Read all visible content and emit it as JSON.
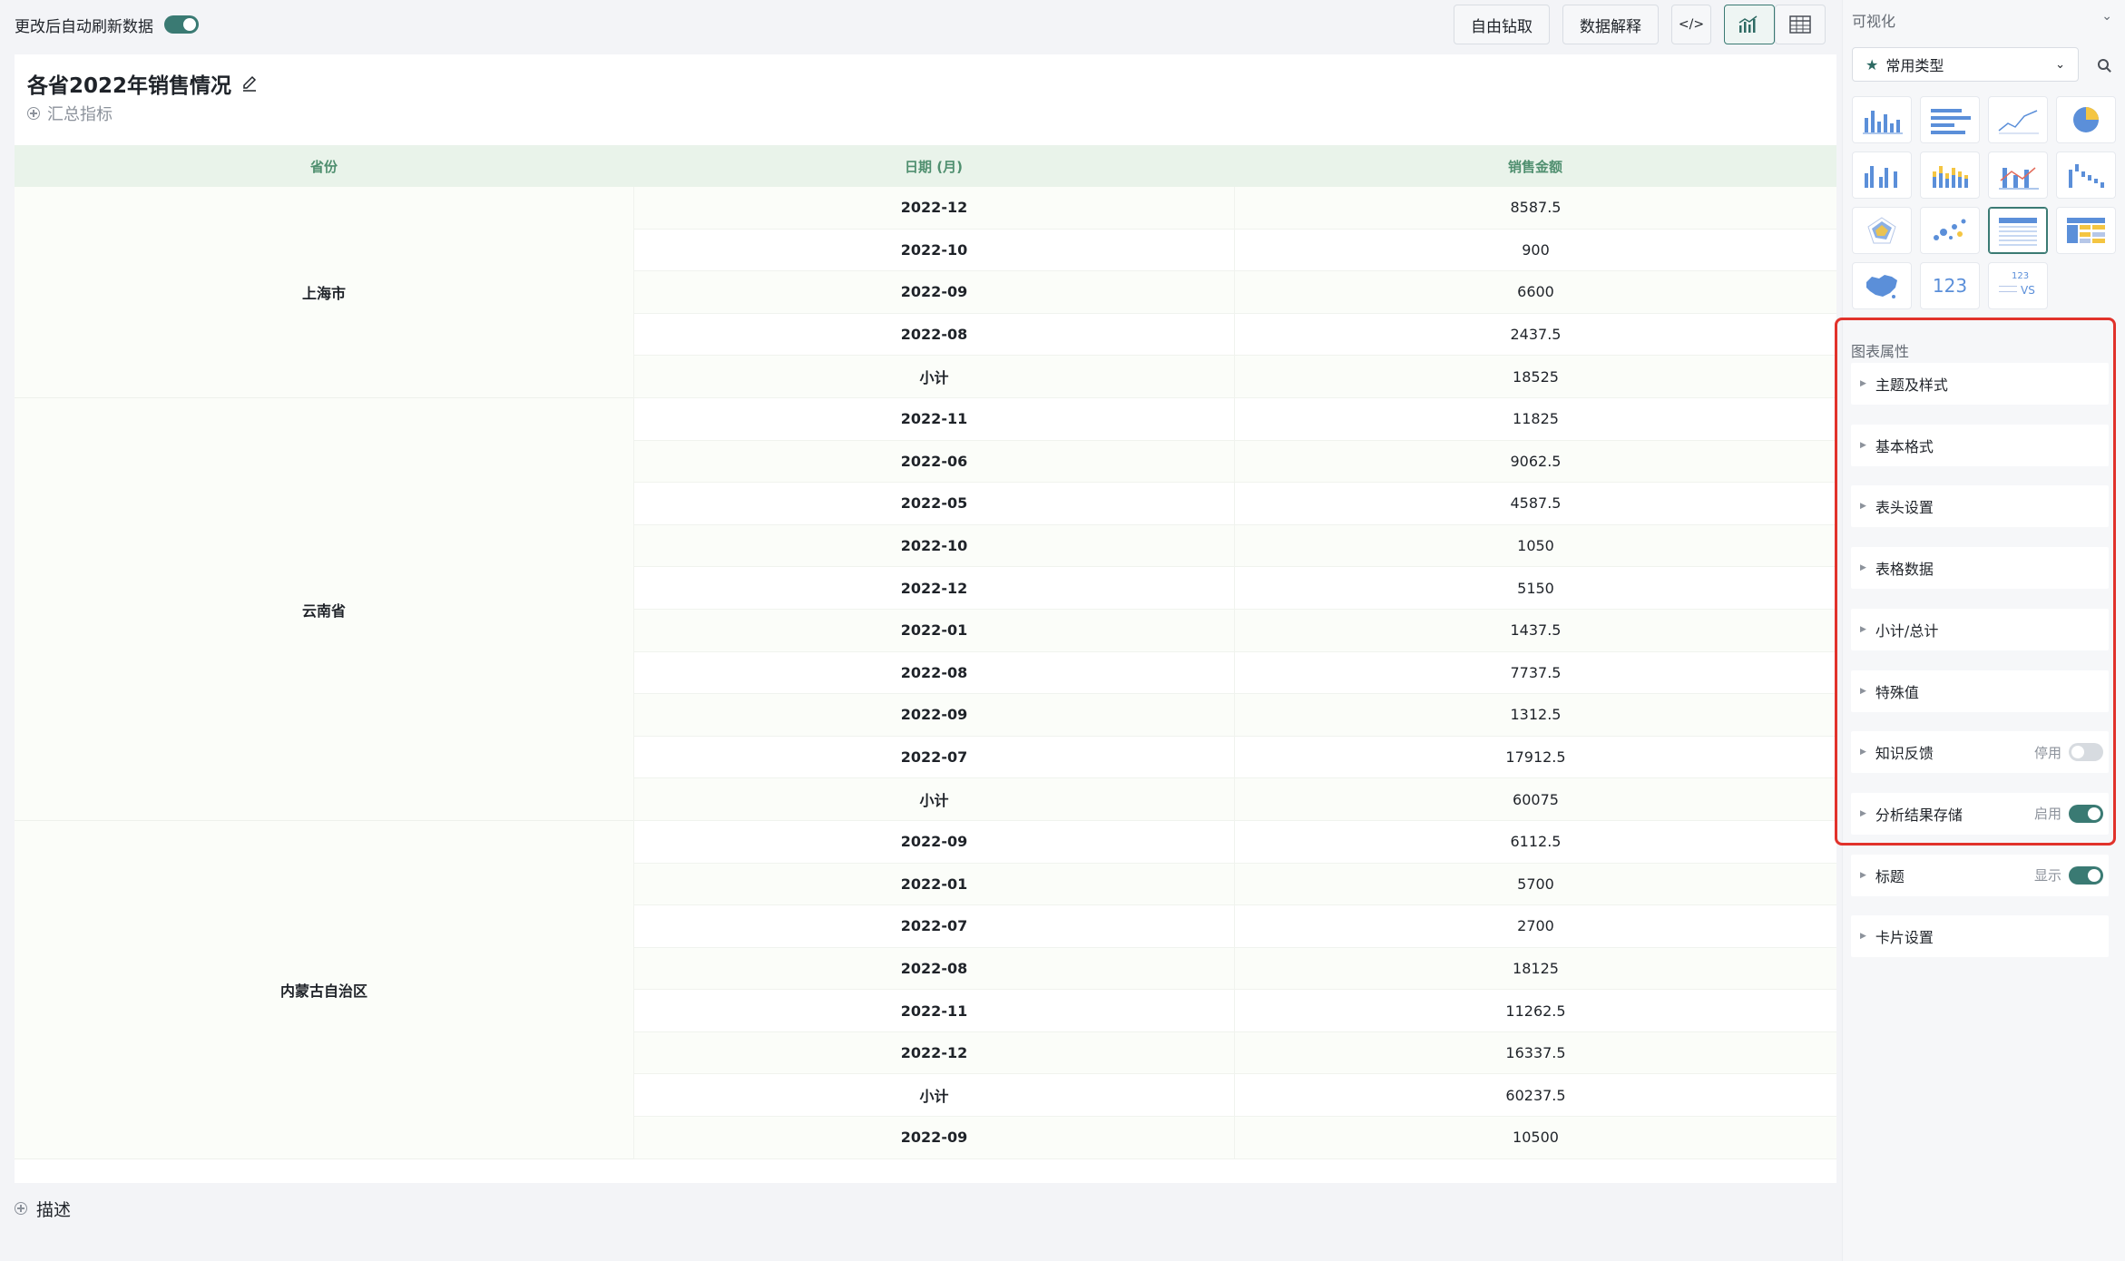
{
  "toolbar": {
    "auto_refresh_label": "更改后自动刷新数据",
    "free_drill_label": "自由钻取",
    "data_explain_label": "数据解释",
    "code_icon": "</>"
  },
  "card": {
    "title": "各省2022年销售情况",
    "summary_label": "汇总指标",
    "columns": [
      "省份",
      "日期 (月)",
      "销售金额"
    ],
    "provinces": [
      "上海市",
      "云南省",
      "内蒙古自治区"
    ],
    "rows": [
      {
        "date": "2022-12",
        "amount": "8587.5"
      },
      {
        "date": "2022-10",
        "amount": "900"
      },
      {
        "date": "2022-09",
        "amount": "6600"
      },
      {
        "date": "2022-08",
        "amount": "2437.5"
      },
      {
        "date": "小计",
        "amount": "18525"
      },
      {
        "date": "2022-11",
        "amount": "11825"
      },
      {
        "date": "2022-06",
        "amount": "9062.5"
      },
      {
        "date": "2022-05",
        "amount": "4587.5"
      },
      {
        "date": "2022-10",
        "amount": "1050"
      },
      {
        "date": "2022-12",
        "amount": "5150"
      },
      {
        "date": "2022-01",
        "amount": "1437.5"
      },
      {
        "date": "2022-08",
        "amount": "7737.5"
      },
      {
        "date": "2022-09",
        "amount": "1312.5"
      },
      {
        "date": "2022-07",
        "amount": "17912.5"
      },
      {
        "date": "小计",
        "amount": "60075"
      },
      {
        "date": "2022-09",
        "amount": "6112.5"
      },
      {
        "date": "2022-01",
        "amount": "5700"
      },
      {
        "date": "2022-07",
        "amount": "2700"
      },
      {
        "date": "2022-08",
        "amount": "18125"
      },
      {
        "date": "2022-11",
        "amount": "11262.5"
      },
      {
        "date": "2022-12",
        "amount": "16337.5"
      },
      {
        "date": "小计",
        "amount": "60237.5"
      },
      {
        "date": "2022-09",
        "amount": "10500"
      }
    ],
    "describe_label": "描述"
  },
  "panel": {
    "title": "可视化",
    "chart_type_select": "常用类型",
    "tile_123_label": "123",
    "tile_vs_label": "VS",
    "tile_vs_num": "123",
    "props_title": "图表属性",
    "props": [
      {
        "label": "主题及样式"
      },
      {
        "label": "基本格式"
      },
      {
        "label": "表头设置"
      },
      {
        "label": "表格数据"
      },
      {
        "label": "小计/总计"
      },
      {
        "label": "特殊值"
      },
      {
        "label": "知识反馈",
        "state": "停用",
        "on": false
      },
      {
        "label": "分析结果存储",
        "state": "启用",
        "on": true
      },
      {
        "label": "标题",
        "state": "显示",
        "on": true
      },
      {
        "label": "卡片设置"
      }
    ]
  },
  "colors": {
    "accent": "#3a7a73",
    "header_bg": "#e9f3ea",
    "header_text": "#4f8f6f",
    "highlight_border": "#e1322b"
  }
}
